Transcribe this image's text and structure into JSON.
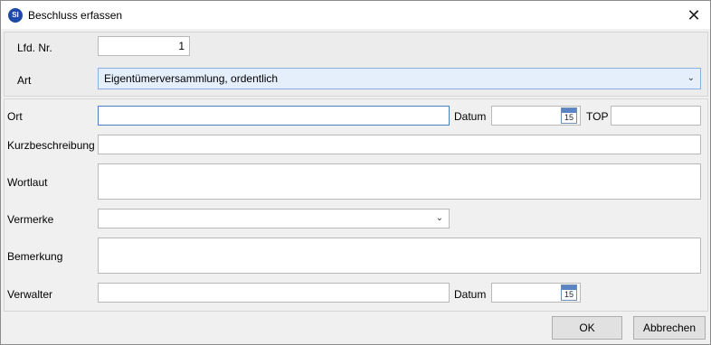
{
  "window": {
    "title": "Beschluss erfassen",
    "app_icon_text": "SI",
    "close_glyph": "✕"
  },
  "header": {
    "lfd_nr_label": "Lfd. Nr.",
    "lfd_nr_value": "1",
    "art_label": "Art",
    "art_value": "Eigentümerversammlung, ordentlich"
  },
  "form": {
    "ort_label": "Ort",
    "ort_value": "",
    "datum_label": "Datum",
    "datum_value": "",
    "top_label": "TOP",
    "top_value": "",
    "kurz_label": "Kurzbeschreibung",
    "kurz_value": "",
    "wortlaut_label": "Wortlaut",
    "wortlaut_value": "",
    "vermerke_label": "Vermerke",
    "vermerke_value": "",
    "bemerkung_label": "Bemerkung",
    "bemerkung_value": "",
    "verwalter_label": "Verwalter",
    "verwalter_value": "",
    "datum2_label": "Datum",
    "datum2_value": "",
    "calendar_day": "15"
  },
  "buttons": {
    "ok": "OK",
    "cancel": "Abbrechen"
  },
  "icons": [
    "app-icon",
    "close-icon",
    "calendar-icon",
    "chevron-down-icon"
  ]
}
